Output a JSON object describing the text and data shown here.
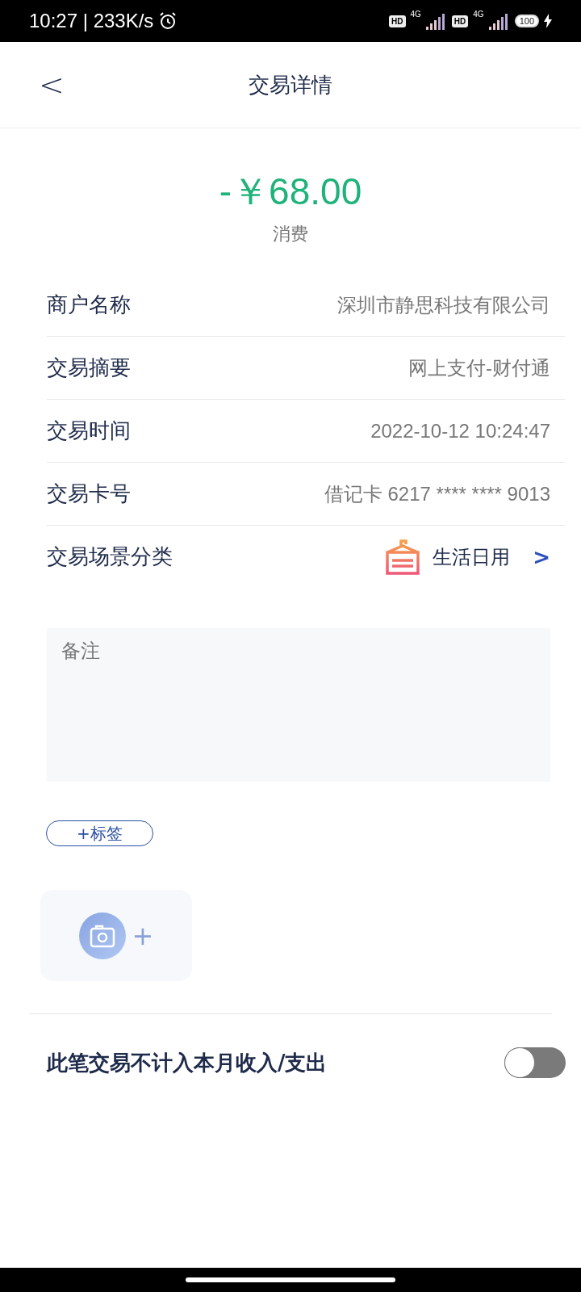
{
  "status_bar": {
    "time": "10:27 | 233K/s",
    "sim_1": {
      "hd": "HD",
      "network": "4G"
    },
    "sim_2": {
      "hd": "HD",
      "network": "4G"
    },
    "battery": "100"
  },
  "header": {
    "back": "<",
    "title": "交易详情"
  },
  "amount": {
    "value": "-￥68.00",
    "type": "消费"
  },
  "details": [
    {
      "label": "商户名称",
      "value": "深圳市静思科技有限公司"
    },
    {
      "label": "交易摘要",
      "value": "网上支付-财付通"
    },
    {
      "label": "交易时间",
      "value": "2022-10-12 10:24:47"
    },
    {
      "label": "交易卡号",
      "value": "借记卡 6217 **** **** 9013"
    },
    {
      "label": "交易场景分类",
      "value": "生活日用",
      "kind": "category",
      "chevron": ">"
    }
  ],
  "note": {
    "placeholder": "备注"
  },
  "tag_button": "+标签",
  "photo_add": {
    "plus": "+"
  },
  "exclude_toggle": {
    "label": "此笔交易不计入本月收入/支出",
    "on": false
  }
}
